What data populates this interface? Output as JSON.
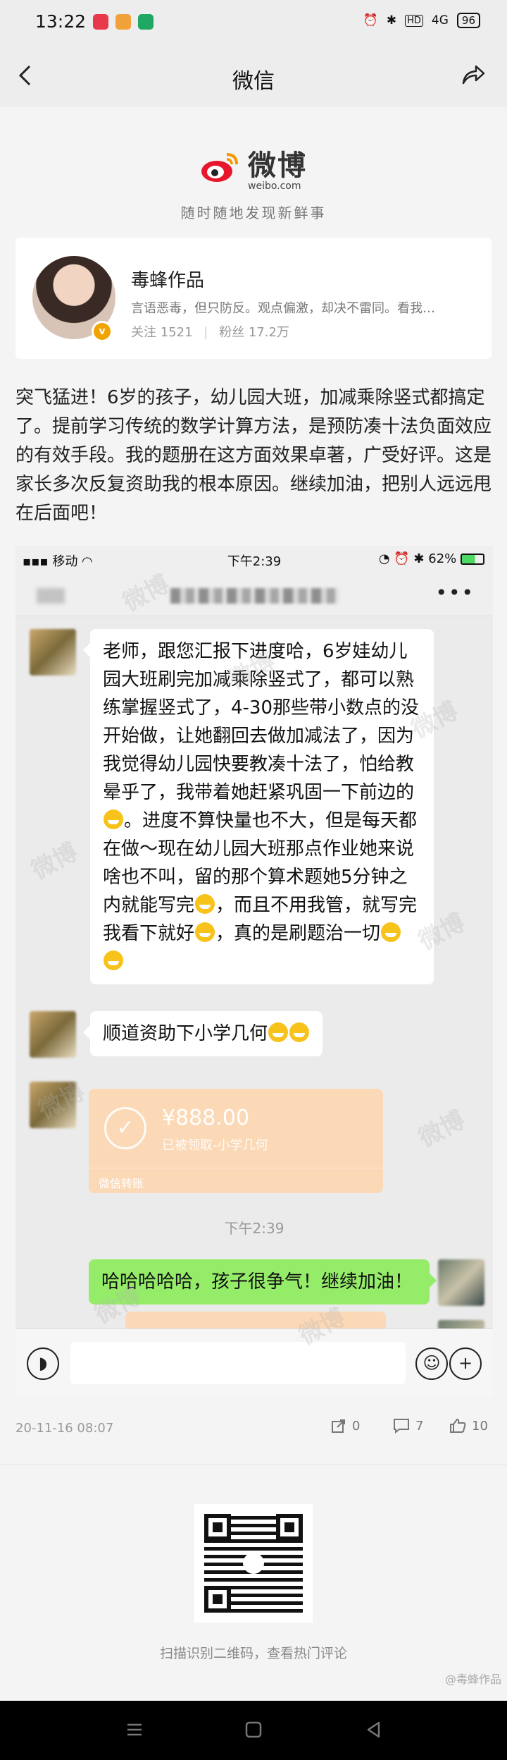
{
  "status_bar": {
    "time": "13:22",
    "signal": "4G",
    "battery": "96",
    "app_icon_colors": [
      "#e8394a",
      "#f0a13a",
      "#1fa764"
    ]
  },
  "nav": {
    "title": "微信",
    "back_icon": "back-arrow-icon",
    "share_icon": "share-icon"
  },
  "weibo_header": {
    "logo": "微博",
    "logo_sub": "weibo.com",
    "slogan": "随时随地发现新鲜事",
    "brand_color": "#e6162d"
  },
  "profile": {
    "name": "毒蜂作品",
    "bio": "言语恶毒，但只防反。观点偏激，却决不雷同。看我…",
    "following_label": "关注",
    "following": "1521",
    "followers_label": "粉丝",
    "followers": "17.2万",
    "badge": "v"
  },
  "post_text": "突飞猛进！6岁的孩子，幼儿园大班，加减乘除竖式都搞定了。提前学习传统的数学计算方法，是预防凑十法负面效应的有效手段。我的题册在这方面效果卓著，广受好评。这是家长多次反复资助我的根本原因。继续加油，把别人远远甩在后面吧！",
  "screenshot": {
    "status": {
      "carrier": "移动",
      "time": "下午2:39",
      "battery": "62%"
    },
    "messages": [
      {
        "side": "left",
        "text": "老师，跟您汇报下进度哈，6岁娃幼儿园大班刷完加减乘除竖式了，都可以熟练掌握竖式了，4-30那些带小数点的没开始做，让她翻回去做加减法了，因为我觉得幼儿园快要教凑十法了，怕给教晕乎了，我带着她赶紧巩固一下前边的",
        "text2": "。进度不算快量也不大，但是每天都在做～现在幼儿园大班那点作业她来说啥也不叫，留的那个算术题她5分钟之内就能写完",
        "text3": "，而且不用我管，就写完我看下就好",
        "text4": "，真的是刷题治一切"
      },
      {
        "side": "left",
        "text": "顺道资助下小学几何"
      },
      {
        "side": "right",
        "text": "哈哈哈哈哈，孩子很争气！继续加油！"
      }
    ],
    "transfer": {
      "amount": "¥888.00",
      "status": "已被领取-小学几何",
      "footer": "微信转账"
    },
    "mid_time": "下午2:39",
    "watermark": "微博"
  },
  "post_footer": {
    "date": "20-11-16 08:07",
    "reposts": "0",
    "comments": "7",
    "likes": "10"
  },
  "qr": {
    "caption": "扫描识别二维码，查看热门评论",
    "mark": "@毒蜂作品"
  }
}
